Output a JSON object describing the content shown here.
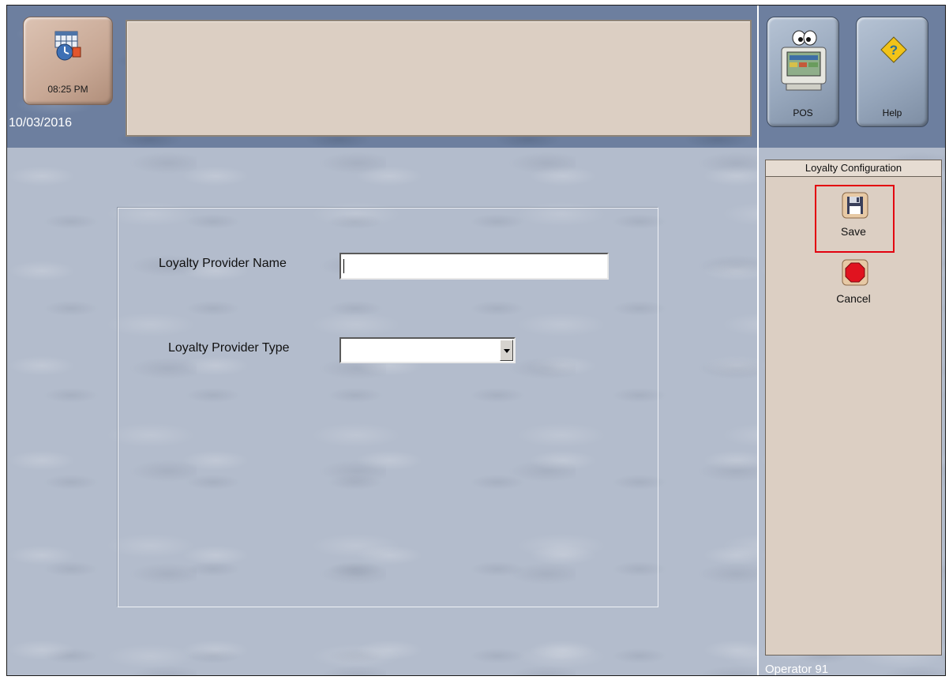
{
  "header": {
    "time": "08:25 PM",
    "date": "10/03/2016"
  },
  "form": {
    "provider_name_label": "Loyalty Provider Name",
    "provider_name_value": "",
    "provider_type_label": "Loyalty Provider Type",
    "provider_type_value": ""
  },
  "nav": {
    "pos_label": "POS",
    "help_label": "Help"
  },
  "side_panel": {
    "title": "Loyalty Configuration",
    "save_label": "Save",
    "cancel_label": "Cancel"
  },
  "status": {
    "operator": "Operator 91"
  },
  "colors": {
    "highlight": "#e3000f",
    "panel_tan": "#dccfc3",
    "texture_blue": "#b3bccc"
  }
}
